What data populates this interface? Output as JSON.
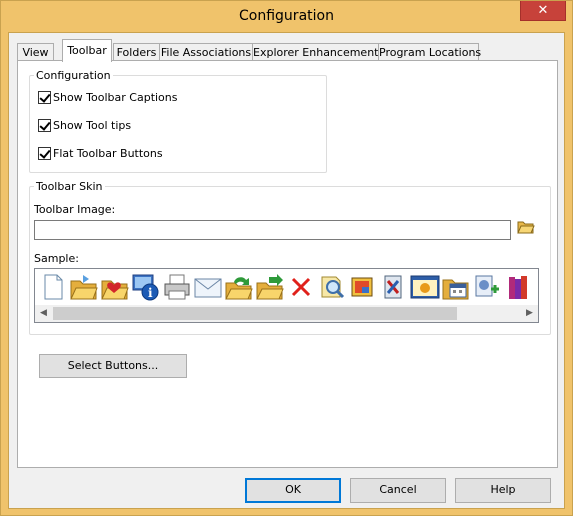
{
  "window": {
    "title": "Configuration",
    "close_glyph": "✕"
  },
  "tabs": [
    {
      "label": "View",
      "active": false
    },
    {
      "label": "Toolbar",
      "active": true
    },
    {
      "label": "Folders",
      "active": false
    },
    {
      "label": "File Associations",
      "active": false
    },
    {
      "label": "Explorer Enhancements",
      "active": false
    },
    {
      "label": "Program Locations",
      "active": false
    }
  ],
  "configuration": {
    "legend": "Configuration",
    "options": [
      {
        "label": "Show Toolbar Captions",
        "checked": true
      },
      {
        "label": "Show Tool tips",
        "checked": true
      },
      {
        "label": "Flat Toolbar Buttons",
        "checked": true
      }
    ]
  },
  "toolbar_skin": {
    "legend": "Toolbar Skin",
    "image_label": "Toolbar Image:",
    "image_value": "",
    "sample_label": "Sample:",
    "icons": [
      "new-document-icon",
      "open-folder-icon",
      "favorite-folder-icon",
      "properties-icon",
      "print-icon",
      "mail-icon",
      "copy-to-folder-icon",
      "move-to-folder-icon",
      "delete-icon",
      "search-icon",
      "image-viewer-icon",
      "tools-icon",
      "slideshow-icon",
      "calendar-folder-icon",
      "add-to-favorites-icon",
      "books-icon"
    ]
  },
  "select_buttons_label": "Select Buttons...",
  "footer": {
    "ok": "OK",
    "cancel": "Cancel",
    "help": "Help"
  },
  "colors": {
    "titlebar": "#f0c36b",
    "close": "#c7423a",
    "accent": "#0078d7"
  }
}
